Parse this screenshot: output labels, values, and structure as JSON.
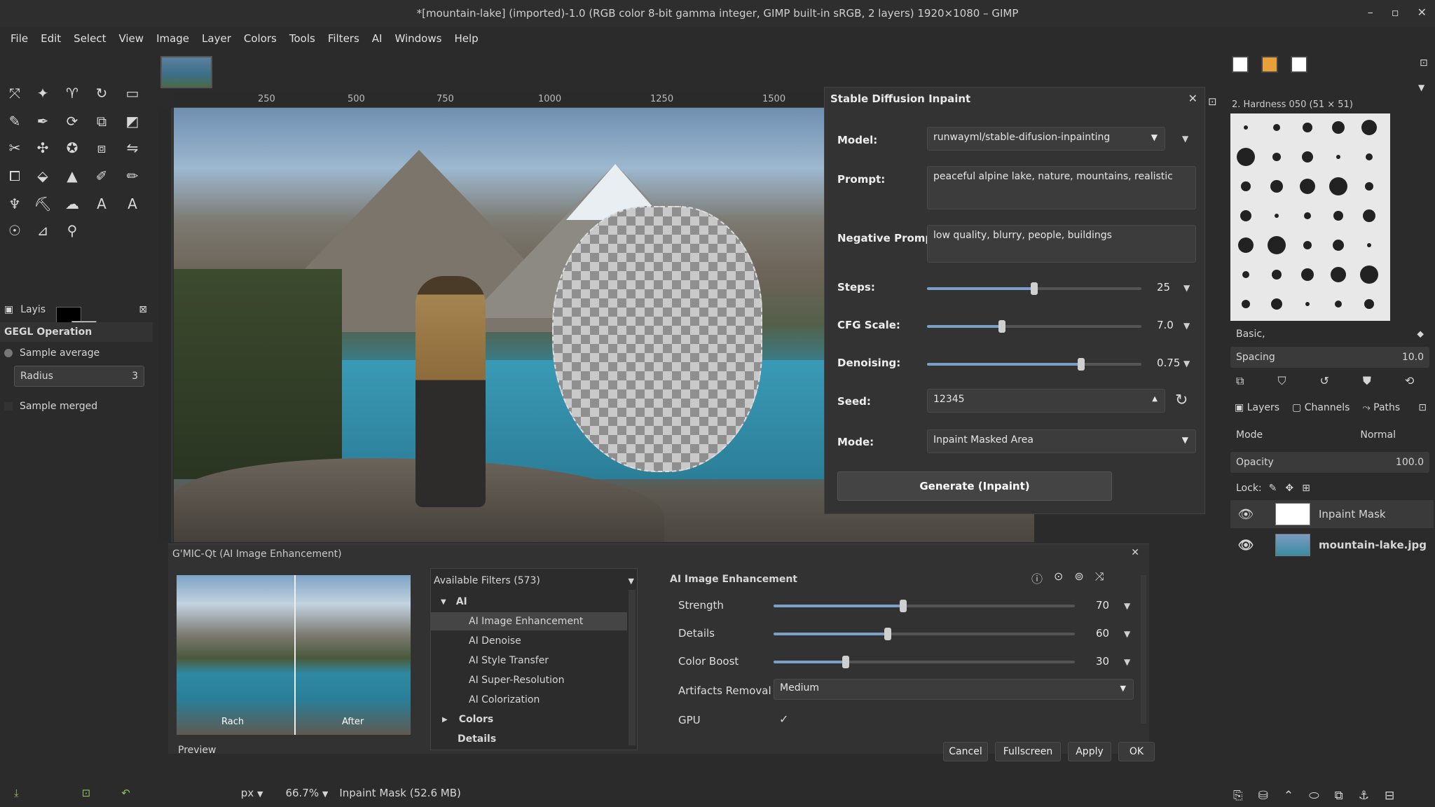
{
  "window": {
    "title": "*[mountain-lake] (imported)-1.0 (RGB color 8-bit gamma integer, GIMP built-in sRGB, 2 layers) 1920×1080 – GIMP",
    "minimize": "–",
    "maximize": "▫",
    "close": "✕"
  },
  "menu": [
    "File",
    "Edit",
    "Select",
    "View",
    "Image",
    "Layer",
    "Colors",
    "Tools",
    "Filters",
    "AI",
    "Windows",
    "Help"
  ],
  "ruler": [
    "250",
    "500",
    "750",
    "1000",
    "1250",
    "1500"
  ],
  "tool_options": {
    "tab": "Layis",
    "header": "GEGL Operation",
    "sample_average": "Sample average",
    "radius_label": "Radius",
    "radius_value": "3",
    "sample_merged": "Sample merged"
  },
  "sd_dialog": {
    "title": "Stable Diffusion Inpaint",
    "model_label": "Model:",
    "model_value": "runwayml/stable-difusion-inpainting",
    "prompt_label": "Prompt:",
    "prompt_value": "peaceful alpine lake, nature, mountains, realistic",
    "neg_label": "Negative Prompt:",
    "neg_value": "low quality, blurry, people, buildings",
    "steps_label": "Steps:",
    "steps_value": "25",
    "steps_frac": 0.5,
    "cfg_label": "CFG Scale:",
    "cfg_value": "7.0",
    "cfg_frac": 0.35,
    "denoise_label": "Denoising:",
    "denoise_value": "0.75",
    "denoise_frac": 0.72,
    "seed_label": "Seed:",
    "seed_value": "12345",
    "mode_label": "Mode:",
    "mode_value": "Inpaint Masked Area",
    "generate": "Generate (Inpaint)"
  },
  "right_panel": {
    "brush_name": "2. Hardness 050 (51 × 51)",
    "brush_set": "Basic,",
    "spacing_label": "Spacing",
    "spacing_value": "10.0",
    "tabs": [
      "Layers",
      "Channels",
      "Paths"
    ],
    "mode_label": "Mode",
    "mode_value": "Normal",
    "opacity_label": "Opacity",
    "opacity_value": "100.0",
    "lock_label": "Lock:",
    "layers": [
      {
        "name": "Inpaint Mask"
      },
      {
        "name": "mountain-lake.jpg"
      }
    ]
  },
  "gmic": {
    "title": "G'MIC-Qt (AI Image Enhancement)",
    "before": "Rach",
    "after": "After",
    "preview": "Preview",
    "filters_header": "Available Filters (573)",
    "tree": [
      {
        "label": "AI",
        "kind": "group-open"
      },
      {
        "label": "AI Image Enhancement",
        "kind": "item-selected"
      },
      {
        "label": "AI Denoise",
        "kind": "item"
      },
      {
        "label": "AI Style Transfer",
        "kind": "item"
      },
      {
        "label": "AI Super-Resolution",
        "kind": "item"
      },
      {
        "label": "AI Colorization",
        "kind": "item"
      },
      {
        "label": "Colors",
        "kind": "group"
      },
      {
        "label": "Details",
        "kind": "group"
      }
    ],
    "params_title": "AI Image Enhancement",
    "strength_label": "Strength",
    "strength_value": "70",
    "strength_frac": 0.43,
    "details_label": "Details",
    "details_value": "60",
    "details_frac": 0.38,
    "boost_label": "Color Boost",
    "boost_value": "30",
    "boost_frac": 0.24,
    "artifacts_label": "Artifacts Removal",
    "artifacts_value": "Medium",
    "gpu_label": "GPU",
    "gpu_check": "✓",
    "cancel": "Cancel",
    "fullscreen": "Fullscreen",
    "apply": "Apply",
    "ok": "OK"
  },
  "status": {
    "unit": "px",
    "zoom": "66.7%",
    "info": "Inpaint Mask (52.6 MB)"
  },
  "colors": {
    "accent": "#7aa0c8",
    "panel": "#333333"
  }
}
